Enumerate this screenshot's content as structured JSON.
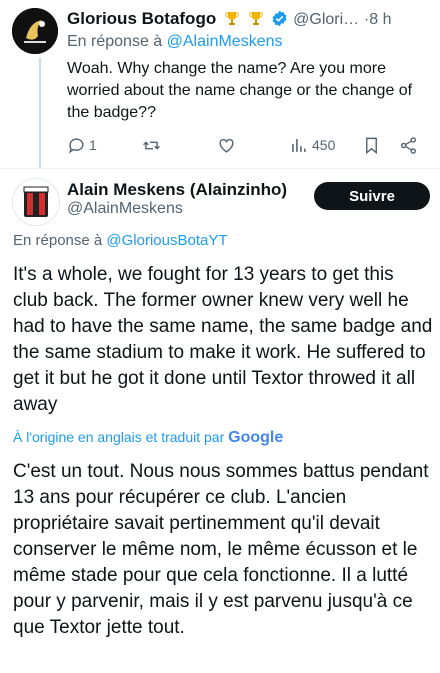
{
  "reply_tweet": {
    "display_name": "Glorious Botafogo",
    "handle": "@Glori…",
    "time": "8 h",
    "in_reply_prefix": "En réponse à",
    "in_reply_handle": "@AlainMeskens",
    "text": "Woah. Why change the name? Are you more worried about the name change or the change of the badge??",
    "reply_count": "1",
    "view_count": "450",
    "icons": [
      "trophy-emoji",
      "trophy-emoji",
      "verified-badge",
      "reply-icon",
      "retweet-icon",
      "like-icon",
      "views-icon",
      "bookmark-icon",
      "share-icon"
    ]
  },
  "main_tweet": {
    "display_name": "Alain Meskens (Alainzinho)",
    "handle": "@AlainMeskens",
    "follow_label": "Suivre",
    "in_reply_prefix": "En réponse à",
    "in_reply_handle": "@GloriousBotaYT",
    "text": "It's a whole, we fought for 13 years to get this club back. The former owner knew very well he had to have the same name, the same badge and the same stadium to make it work. He suffered to get it but he got it done until Textor throwed it all away",
    "translation_note": "À l'origine en anglais et traduit par",
    "translation_provider": "Google",
    "translated_text": "C'est un tout. Nous nous sommes battus pendant 13 ans pour récupérer ce club. L'ancien propriétaire savait pertinemment qu'il devait conserver le même nom, le même écusson et le même stade pour que cela fonctionne. Il a lutté pour y parvenir, mais il y est parvenu jusqu'à ce que Textor jette tout."
  },
  "colors": {
    "link": "#1d9bf0",
    "muted": "#536471",
    "text": "#0f1419",
    "follow_bg": "#0f1419"
  }
}
